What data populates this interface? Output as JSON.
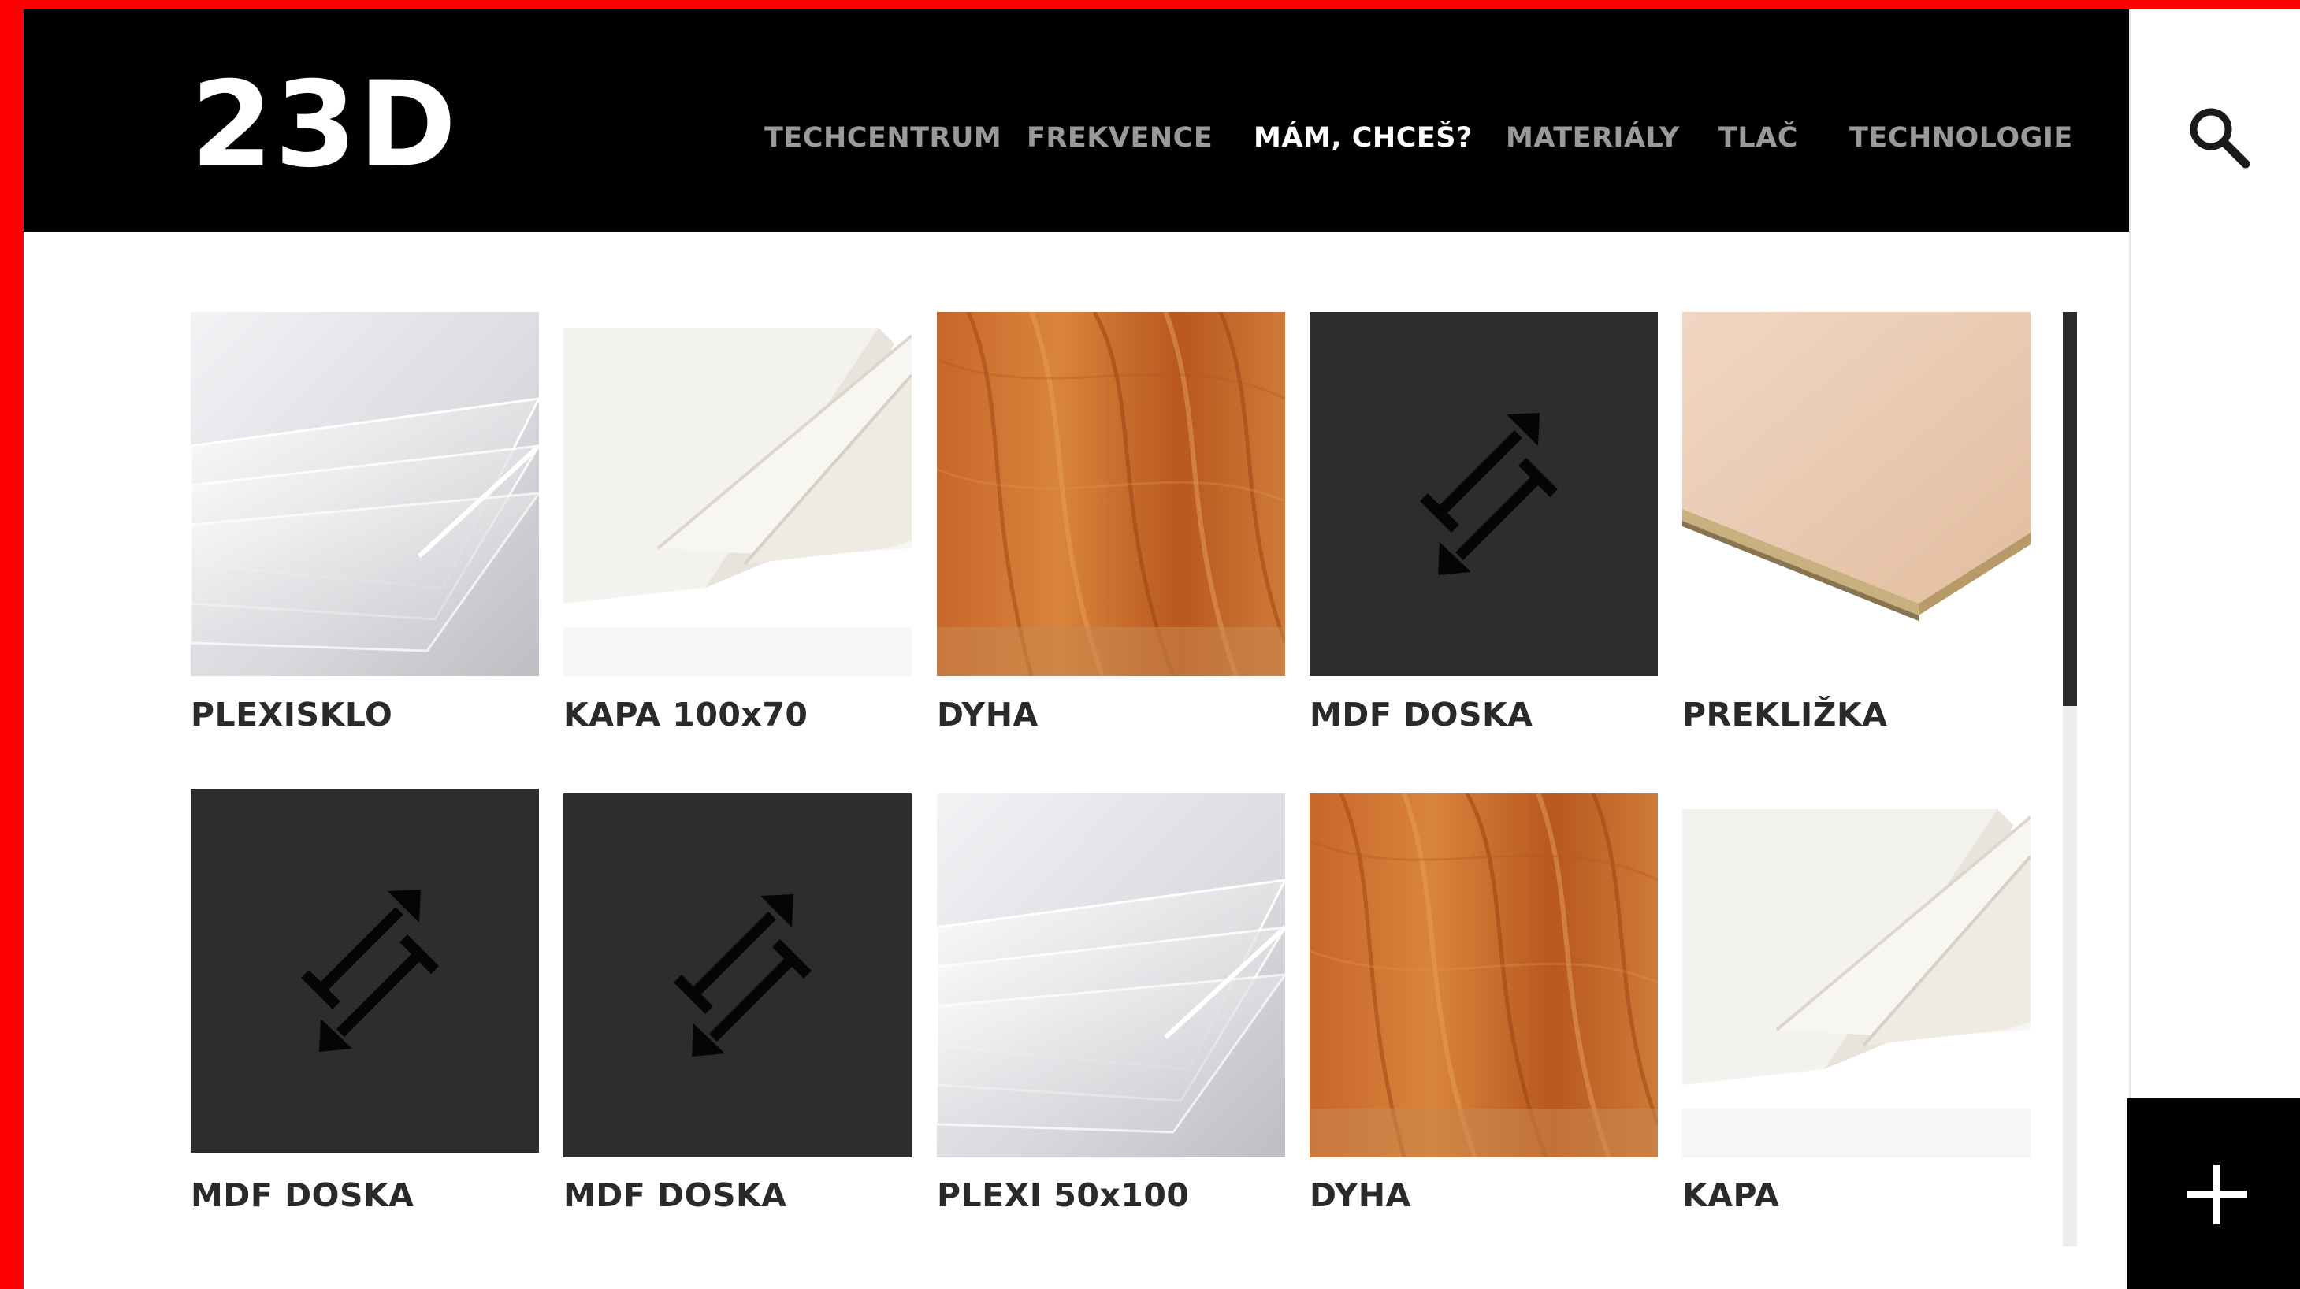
{
  "brand": {
    "logo_text": "23D"
  },
  "nav": {
    "items": [
      {
        "label": "TECHCENTRUM",
        "active": false
      },
      {
        "label": "FREKVENCE",
        "active": false
      },
      {
        "label": "MÁM, CHCEŠ?",
        "active": true
      },
      {
        "label": "MATERIÁLY",
        "active": false
      },
      {
        "label": "TLAČ",
        "active": false
      },
      {
        "label": "TECHNOLOGIE",
        "active": false
      }
    ]
  },
  "materials": [
    {
      "label": "PLEXISKLO",
      "image": "acrylic-sheets"
    },
    {
      "label": "KAPA 100x70",
      "image": "foam-board-sheets"
    },
    {
      "label": "DYHA",
      "image": "wood-veneer"
    },
    {
      "label": "MDF DOSKA",
      "image": "dimension-arrows-placeholder"
    },
    {
      "label": "PREKLIŽKA",
      "image": "plywood-sheets"
    },
    {
      "label": "MDF DOSKA",
      "image": "dimension-arrows-placeholder"
    },
    {
      "label": "MDF DOSKA",
      "image": "dimension-arrows-placeholder"
    },
    {
      "label": "PLEXI 50x100",
      "image": "acrylic-sheets"
    },
    {
      "label": "DYHA",
      "image": "wood-veneer"
    },
    {
      "label": "KAPA",
      "image": "foam-board-sheets"
    }
  ],
  "icons": {
    "search": "search-icon",
    "add": "plus-icon"
  },
  "colors": {
    "frame": "#fe0000",
    "header_bg": "#000000",
    "nav_inactive": "#9a9a9a",
    "nav_active": "#ffffff",
    "label": "#2a2a2a",
    "placeholder_bg": "#2d2d2d"
  }
}
